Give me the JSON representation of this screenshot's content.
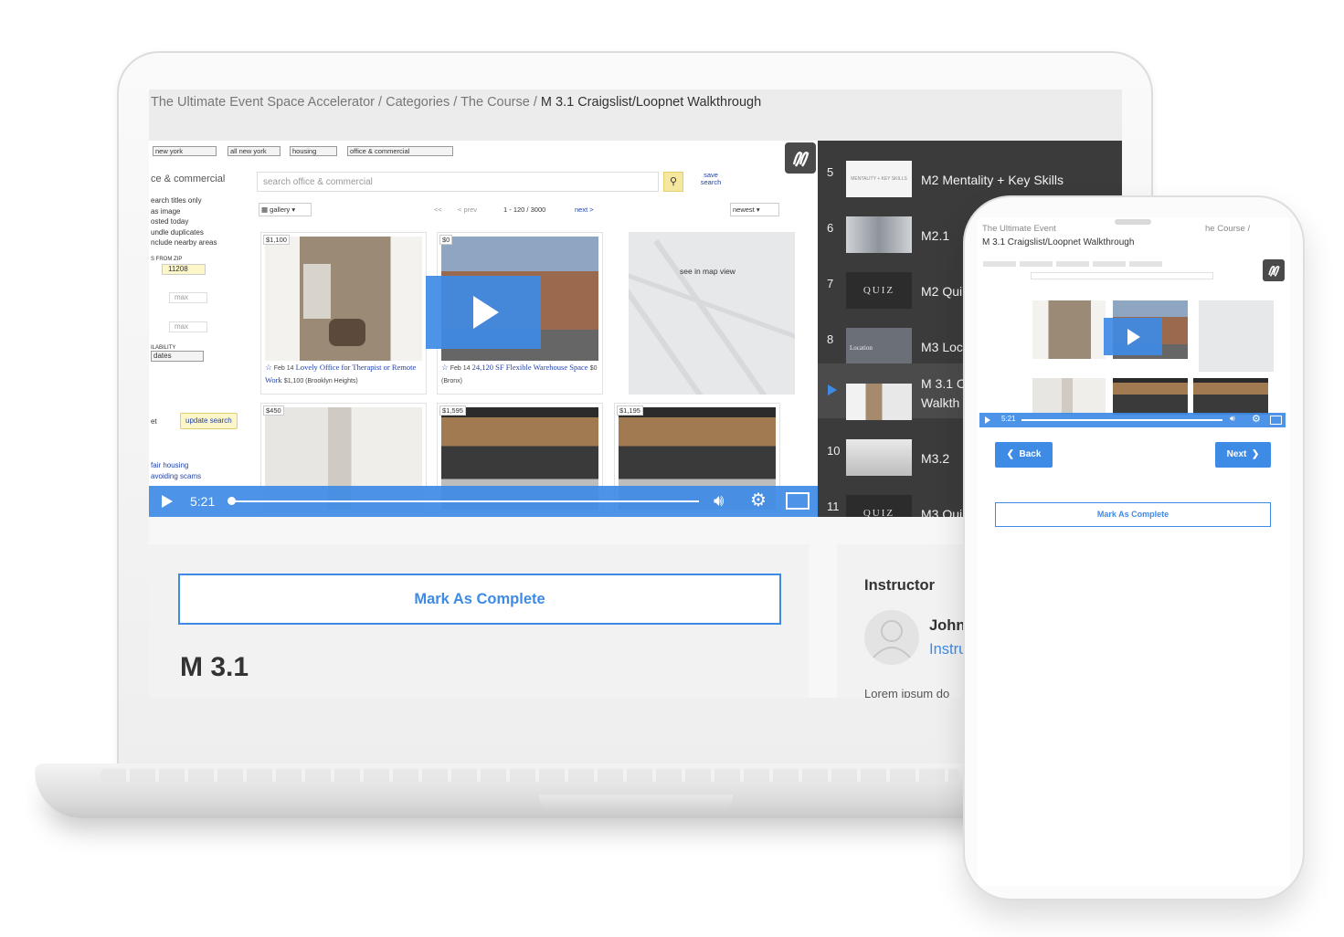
{
  "breadcrumb": {
    "items": [
      "The Ultimate Event Space Accelerator",
      "Categories",
      "The Course"
    ],
    "separator": " / ",
    "current": "M 3.1 Craigslist/Loopnet Walkthrough"
  },
  "video_preview": {
    "selects": [
      "new york",
      "all new york",
      "housing",
      "office & commercial"
    ],
    "category_title": "ce & commercial",
    "search_placeholder": "search office & commercial",
    "save_search": "save search",
    "filters": [
      "earch titles only",
      "as image",
      "osted today",
      "undle duplicates",
      "nclude nearby areas"
    ],
    "from_zip_label": "S FROM ZIP",
    "zip_value": "11208",
    "max_label": "max",
    "availability_label": "ILABILITY",
    "availability_value": "dates",
    "update_search": "update search",
    "footer_links": [
      "fair housing",
      "avoiding scams"
    ],
    "view_mode": "gallery",
    "pagination": {
      "first": "<<",
      "prev": "< prev",
      "range": "1 - 120 / 3000",
      "next": "next >"
    },
    "sort": "newest",
    "map_text": "see in map view",
    "listings": [
      {
        "price": "$1,100",
        "date": "Feb 14",
        "title": "Lovely Office for Therapist or Remote Work",
        "meta": "$1,100  (Brooklyn Heights)"
      },
      {
        "price": "$0",
        "date": "Feb 14",
        "title": "24,120 SF Flexible Warehouse Space",
        "meta": "$0  (Bronx)"
      },
      {
        "price": "$450"
      },
      {
        "price": "$1,595"
      },
      {
        "price": "$1,195"
      }
    ],
    "label_partial": "et"
  },
  "player": {
    "time": "5:21",
    "progress": 0
  },
  "playlist": [
    {
      "num": "5",
      "title": "M2 Mentality + Key Skills",
      "thumb": "MENTALITY + KEY SKILLS"
    },
    {
      "num": "6",
      "title": "M2.1",
      "thumb": ""
    },
    {
      "num": "7",
      "title": "M2 Qui",
      "thumb": "QUIZ"
    },
    {
      "num": "8",
      "title": "M3 Loc",
      "thumb": "Location"
    },
    {
      "num": "",
      "title": "M 3.1 C",
      "title2": "Walkth",
      "thumb": "",
      "active": true
    },
    {
      "num": "10",
      "title": "M3.2",
      "thumb": ""
    },
    {
      "num": "11",
      "title": "M3 Qui",
      "thumb": "QUIZ"
    }
  ],
  "main": {
    "mark_complete": "Mark As Complete",
    "lesson_title": "M 3.1"
  },
  "sidebar": {
    "heading": "Instructor",
    "instructor_name": "John",
    "instructor_role": "Instru",
    "bio": "Lorem ipsum do"
  },
  "phone": {
    "crumb_start": "The Ultimate Event",
    "crumb_end": "he Course /",
    "crumb_current": "M 3.1 Craigslist/Loopnet Walkthrough",
    "time": "5:21",
    "back": "Back",
    "next": "Next",
    "mark_complete": "Mark As Complete"
  },
  "colors": {
    "accent": "#3e8be6",
    "playlist_bg": "#3b3b3b",
    "page_bg": "#f2f2f2"
  }
}
